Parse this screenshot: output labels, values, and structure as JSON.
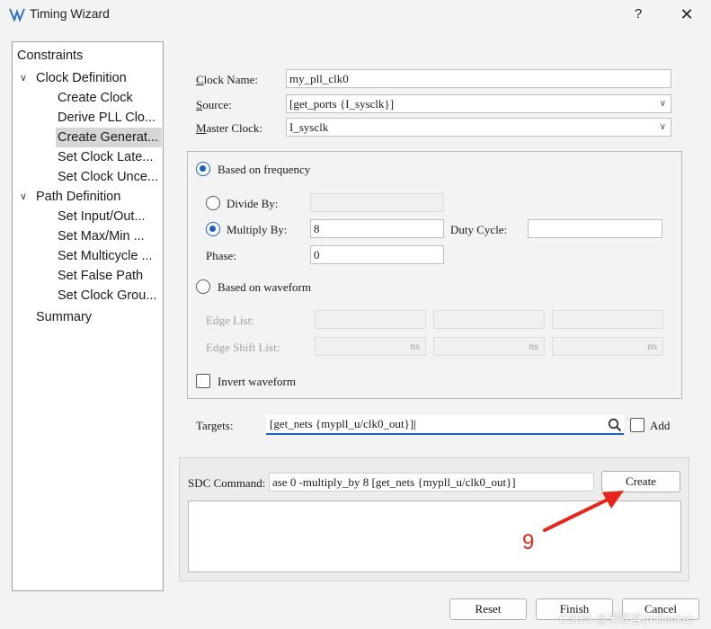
{
  "window": {
    "title": "Timing Wizard",
    "help": "?",
    "close": "✕",
    "icon": "timing-wizard-icon"
  },
  "tree": {
    "items": [
      {
        "label": "Constraints",
        "level": 0
      },
      {
        "label": "Clock Definition",
        "level": 1,
        "expanded": true
      },
      {
        "label": "Create Clock",
        "level": 2
      },
      {
        "label": "Derive PLL Clo...",
        "level": 2
      },
      {
        "label": "Create Generat...",
        "level": 2,
        "selected": true
      },
      {
        "label": "Set Clock Late...",
        "level": 2
      },
      {
        "label": "Set Clock Unce...",
        "level": 2
      },
      {
        "label": "Path Definition",
        "level": 1,
        "expanded": true
      },
      {
        "label": "Set Input/Out...",
        "level": 2
      },
      {
        "label": "Set Max/Min ...",
        "level": 2
      },
      {
        "label": "Set Multicycle ...",
        "level": 2
      },
      {
        "label": "Set False Path",
        "level": 2
      },
      {
        "label": "Set Clock Grou...",
        "level": 2
      },
      {
        "label": "Summary",
        "level": 1
      }
    ]
  },
  "form": {
    "clock_name_label_a": "C",
    "clock_name_label_b": "lock Name:",
    "clock_name_value": "my_pll_clk0",
    "source_label_a": "S",
    "source_label_b": "ource:",
    "source_value": "[get_ports {I_sysclk}]",
    "master_label_a": "M",
    "master_label_b": "aster Clock:",
    "master_value": "I_sysclk",
    "based_on_frequency": "Based on frequency",
    "divide_by_label": "Divide By:",
    "divide_by_value": "",
    "multiply_by_label": "Multiply By:",
    "multiply_by_value": "8",
    "duty_cycle_label": "Duty Cycle:",
    "duty_cycle_value": "",
    "phase_label": "Phase:",
    "phase_value": "0",
    "based_on_waveform": "Based on waveform",
    "edge_list_label": "Edge List:",
    "edge_shift_label": "Edge Shift List:",
    "ns_unit": "ns",
    "invert_waveform": "Invert waveform",
    "targets_label": "Targets:",
    "targets_value": "[get_nets {mypll_u/clk0_out}]",
    "add_label": "Add",
    "sdc_label": "SDC Command:",
    "sdc_value": "ase 0 -multiply_by 8 [get_nets {mypll_u/clk0_out}]",
    "create_button": "Create"
  },
  "buttons": {
    "reset": "Reset",
    "finish": "Finish",
    "cancel": "Cancel"
  },
  "annotation": {
    "number": "9",
    "color": "#e8251a"
  },
  "watermark": "CSDN @米联客(milianke)",
  "colors": {
    "accent": "#1c5fbf",
    "selection": "#d6d6d6"
  }
}
